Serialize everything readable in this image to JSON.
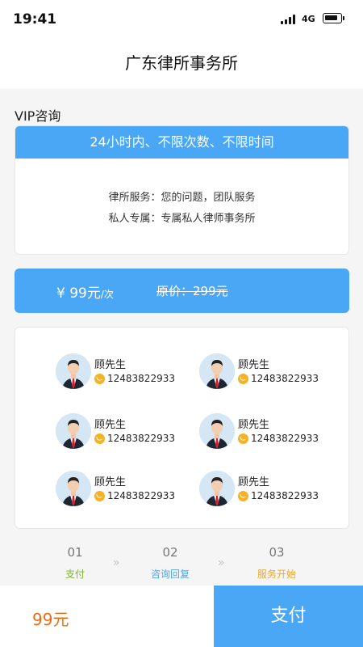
{
  "status_bar": {
    "time": "19:41",
    "network": "4G"
  },
  "nav": {
    "title": "广东律所事务所"
  },
  "section": {
    "title": "VIP咨询"
  },
  "vip_card": {
    "banner": "24小时内、不限次数、不限时间",
    "line1": "律所服务：您的问题，团队服务",
    "line2": "私人专属：专属私人律师事务所"
  },
  "price_bar": {
    "current": "¥ 99元",
    "unit": "/次",
    "original": "原价：299元"
  },
  "lawyers": [
    {
      "name": "顾先生",
      "phone": "12483822933"
    },
    {
      "name": "顾先生",
      "phone": "12483822933"
    },
    {
      "name": "顾先生",
      "phone": "12483822933"
    },
    {
      "name": "顾先生",
      "phone": "12483822933"
    },
    {
      "name": "顾先生",
      "phone": "12483822933"
    },
    {
      "name": "顾先生",
      "phone": "12483822933"
    }
  ],
  "steps": [
    {
      "num": "01",
      "label": "支付",
      "color": "#7ab52a"
    },
    {
      "num": "02",
      "label": "咨询回复",
      "color": "#49a7f5"
    },
    {
      "num": "03",
      "label": "服务开始",
      "color": "#f5a623"
    }
  ],
  "step_arrow": "»",
  "bottom": {
    "total": "99元",
    "pay_label": "支付"
  },
  "colors": {
    "accent": "#49a7f5",
    "price_orange": "#f06a12",
    "phone_badge": "#f5b323"
  }
}
